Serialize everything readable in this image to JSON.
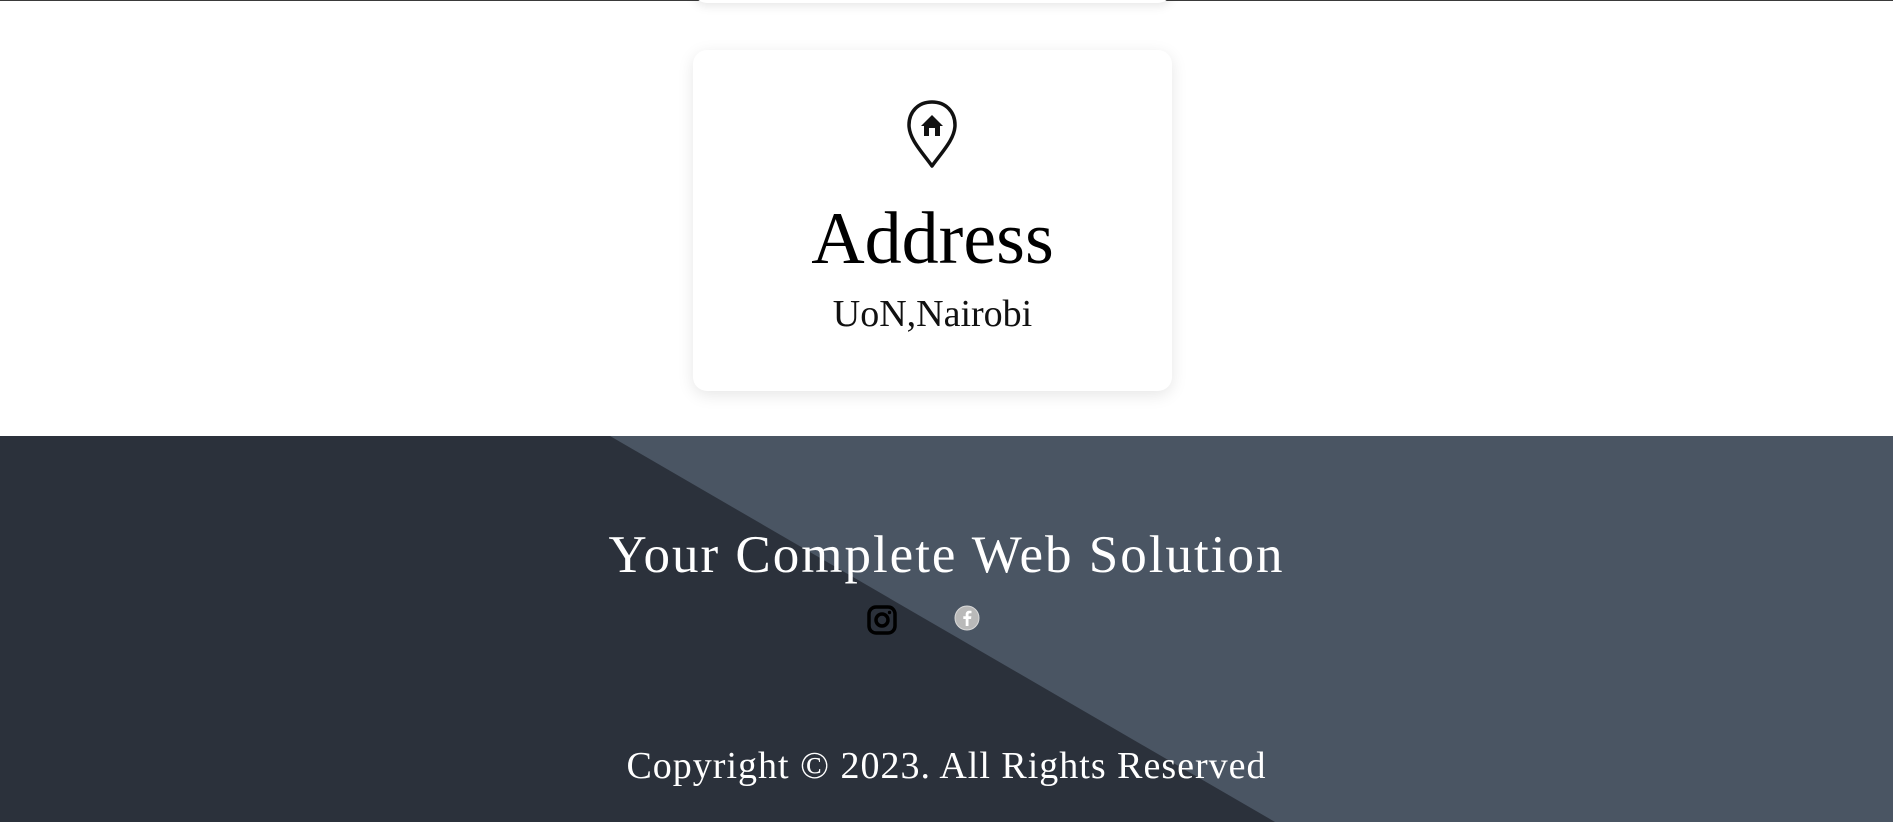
{
  "contact_card": {
    "icon": "map-pin-home-icon",
    "title": "Address",
    "text": "UoN,Nairobi"
  },
  "footer": {
    "tagline": "Your Complete Web Solution",
    "socials": [
      {
        "name": "instagram-icon"
      },
      {
        "name": "facebook-icon"
      }
    ],
    "copyright": "Copyright © 2023. All Rights Reserved"
  },
  "colors": {
    "footer_dark": "#2b313b",
    "footer_light": "#4a5563",
    "card_background": "#ffffff",
    "text_on_footer": "#ffffff"
  }
}
